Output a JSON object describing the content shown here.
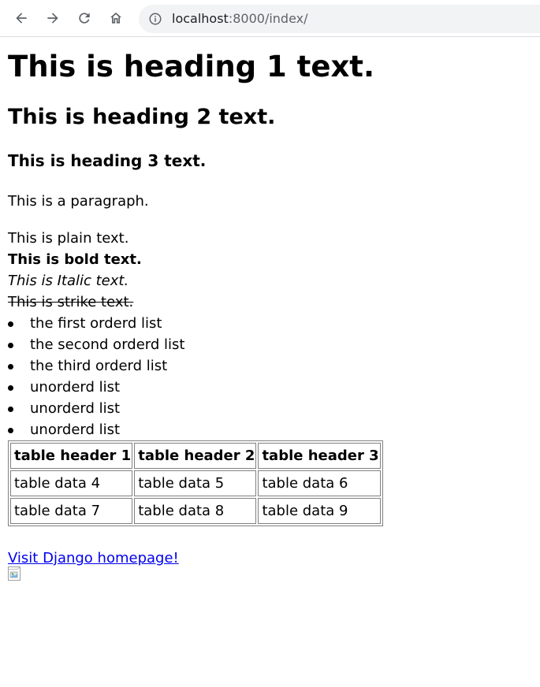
{
  "browser": {
    "url_host": "localhost",
    "url_path": ":8000/index/",
    "icons": {
      "back": "arrow-left-icon",
      "forward": "arrow-right-icon",
      "reload": "reload-icon",
      "home": "home-icon",
      "site_info": "info-circle-icon"
    }
  },
  "content": {
    "h1": "This is heading 1 text.",
    "h2": "This is heading 2 text.",
    "h3": "This is heading 3 text.",
    "paragraph": "This is a paragraph.",
    "plain": "This is plain text.",
    "bold": "This is bold text.",
    "italic": "This is Italic text.",
    "strike": "This is strike text.",
    "list": [
      "the first orderd list",
      "the second orderd list",
      "the third orderd list",
      "unorderd list",
      "unorderd list",
      "unorderd list"
    ],
    "table": {
      "headers": [
        "table header 1",
        "table header 2",
        "table header 3"
      ],
      "rows": [
        [
          "table data 4",
          "table data 5",
          "table data 6"
        ],
        [
          "table data 7",
          "table data 8",
          "table data 9"
        ]
      ]
    },
    "link": "Visit Django homepage!"
  },
  "colors": {
    "link": "#0000ee",
    "omnibox_bg": "#f1f3f4",
    "border": "#808080"
  }
}
